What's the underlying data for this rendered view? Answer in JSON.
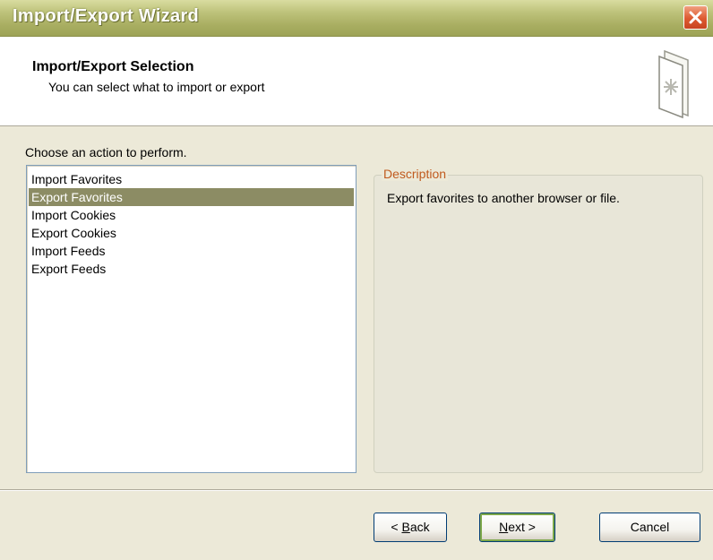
{
  "window": {
    "title": "Import/Export Wizard",
    "close_icon": "close-icon"
  },
  "header": {
    "title": "Import/Export Selection",
    "subtitle": "You can select what to import or export",
    "icon": "wizard-page-icon"
  },
  "main": {
    "choose_label": "Choose an action to perform.",
    "actions": [
      {
        "label": "Import Favorites",
        "selected": false
      },
      {
        "label": "Export Favorites",
        "selected": true
      },
      {
        "label": "Import Cookies",
        "selected": false
      },
      {
        "label": "Export Cookies",
        "selected": false
      },
      {
        "label": "Import Feeds",
        "selected": false
      },
      {
        "label": "Export Feeds",
        "selected": false
      }
    ],
    "description": {
      "legend": "Description",
      "text": "Export favorites to another browser or file."
    }
  },
  "buttons": {
    "back": {
      "prefix": "< ",
      "mnemonic": "B",
      "rest": "ack"
    },
    "next": {
      "mnemonic": "N",
      "rest": "ext >"
    },
    "cancel": "Cancel"
  },
  "colors": {
    "accent_legend": "#c05a1e",
    "selection": "#8c8c64",
    "close_button": "#dd5a30"
  }
}
